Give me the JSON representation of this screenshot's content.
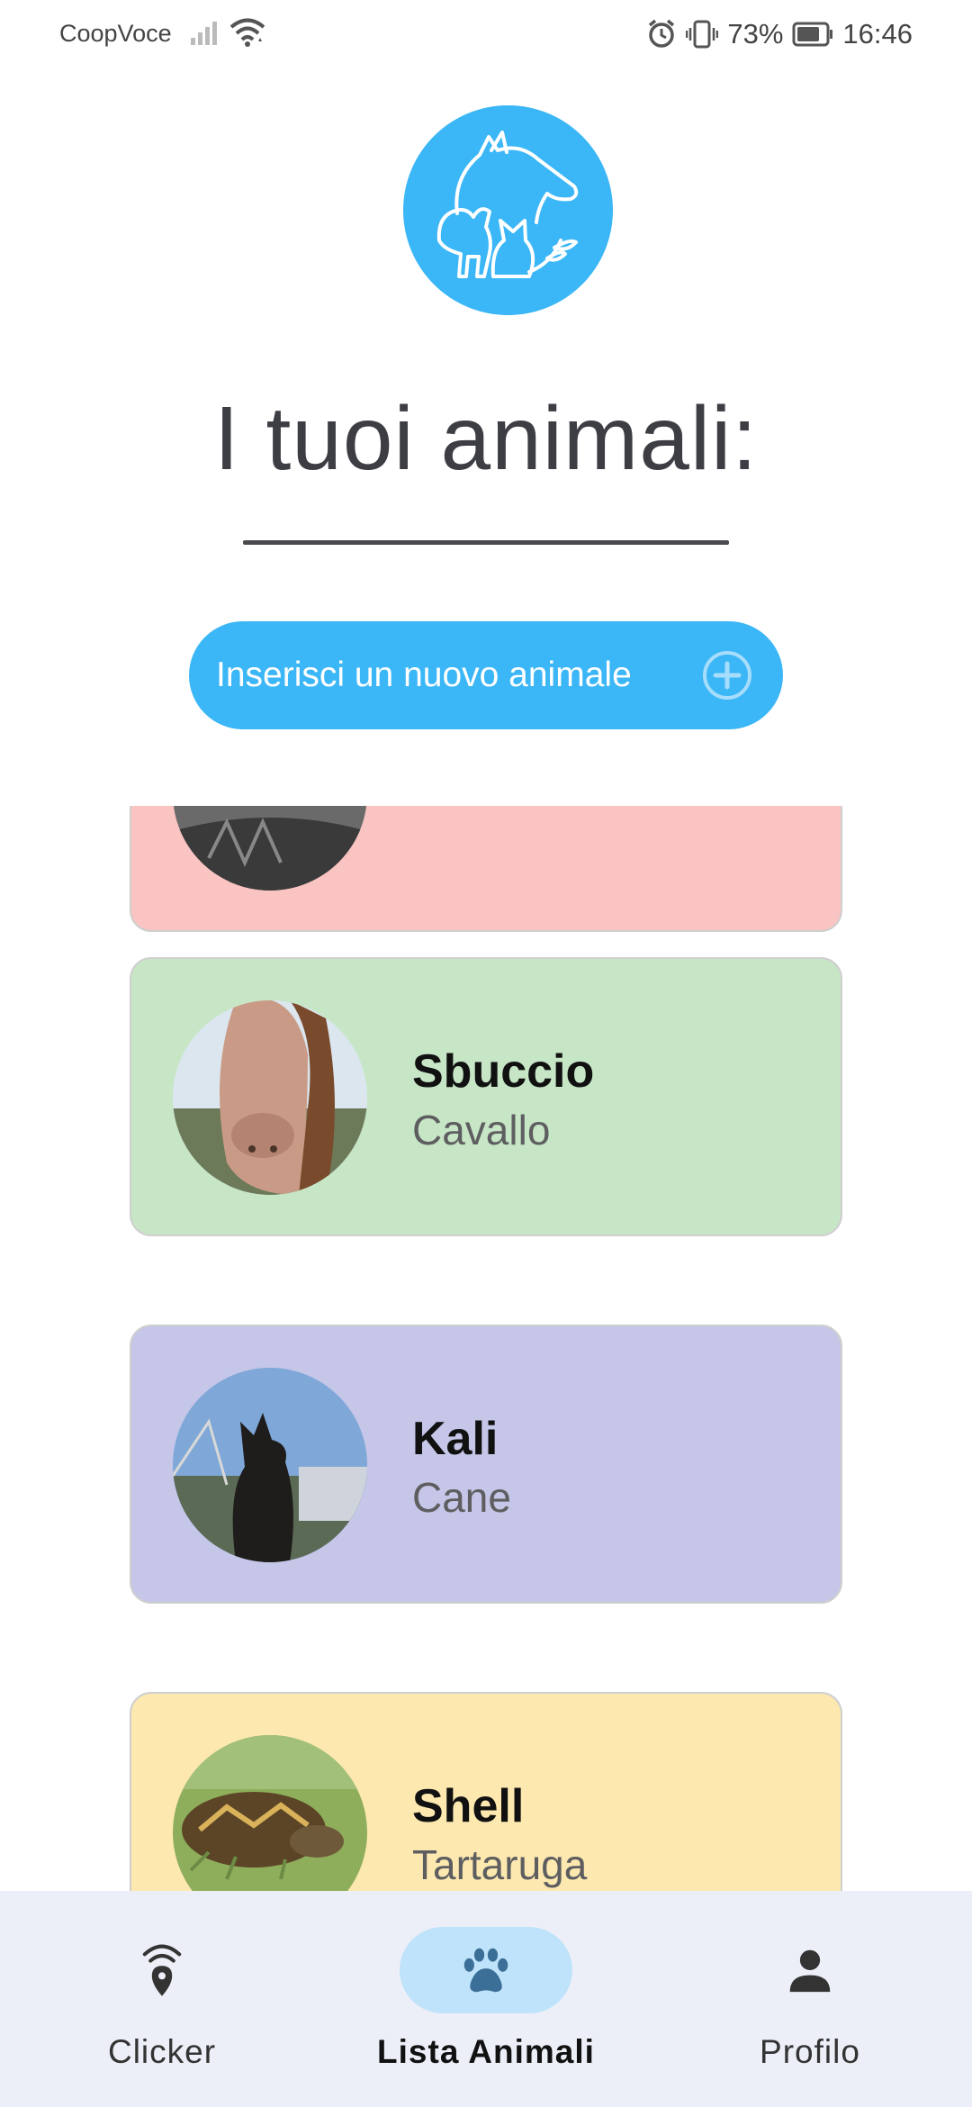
{
  "status_bar": {
    "carrier": "CoopVoce",
    "battery": "73%",
    "time": "16:46"
  },
  "header": {
    "title": "I tuoi animali:"
  },
  "add_button": {
    "label": "Inserisci un nuovo animale"
  },
  "pets": [
    {
      "name": "",
      "species": "",
      "color": "#f9c4c2"
    },
    {
      "name": "Sbuccio",
      "species": "Cavallo",
      "color": "#c7e6c6"
    },
    {
      "name": "Kali",
      "species": "Cane",
      "color": "#c5c6e8"
    },
    {
      "name": "Shell",
      "species": "Tartaruga",
      "color": "#fde9b0"
    }
  ],
  "bottom_nav": {
    "items": [
      {
        "label": "Clicker",
        "icon": "clicker-location-icon",
        "active": false
      },
      {
        "label": "Lista Animali",
        "icon": "paw-icon",
        "active": true
      },
      {
        "label": "Profilo",
        "icon": "person-icon",
        "active": false
      }
    ]
  },
  "colors": {
    "accent": "#3bb6f6",
    "nav_background": "#eceff7",
    "nav_active_pill": "#bfe3fb"
  }
}
